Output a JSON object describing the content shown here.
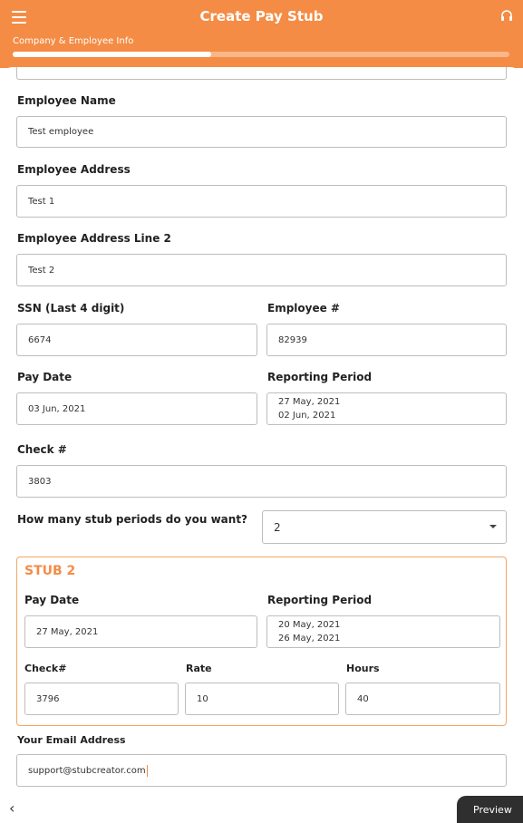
{
  "header": {
    "title": "Create Pay Stub",
    "step_label": "Company & Employee Info",
    "progress": 0.4
  },
  "form": {
    "employee_name_label": "Employee Name",
    "employee_name_value": "Test employee",
    "employee_address_label": "Employee Address",
    "employee_address_value": "Test 1",
    "employee_address2_label": "Employee Address Line 2",
    "employee_address2_value": "Test 2",
    "ssn_label": "SSN (Last 4 digit)",
    "ssn_value": "6674",
    "employee_num_label": "Employee #",
    "employee_num_value": "82939",
    "pay_date_label": "Pay Date",
    "pay_date_value": "03 Jun, 2021",
    "reporting_period_label": "Reporting Period",
    "reporting_period_start": "27 May, 2021",
    "reporting_period_end": "02 Jun, 2021",
    "check_label": "Check #",
    "check_value": "3803",
    "stub_periods_label": "How many stub periods do you want?",
    "stub_periods_value": "2"
  },
  "stub2": {
    "title": "STUB 2",
    "pay_date_label": "Pay Date",
    "pay_date_value": "27 May, 2021",
    "reporting_period_label": "Reporting Period",
    "reporting_period_start": "20 May, 2021",
    "reporting_period_end": "26 May, 2021",
    "check_label": "Check#",
    "check_value": "3796",
    "rate_label": "Rate",
    "rate_value": "10",
    "hours_label": "Hours",
    "hours_value": "40"
  },
  "email": {
    "label": "Your Email Address",
    "value": "support@stubcreator.com"
  },
  "footer": {
    "back_glyph": "‹",
    "preview_label": "Preview"
  },
  "icons": {
    "menu": "menu-icon",
    "support": "headset-icon",
    "dropdown": "caret-down-icon"
  },
  "colors": {
    "accent": "#f48c45"
  }
}
